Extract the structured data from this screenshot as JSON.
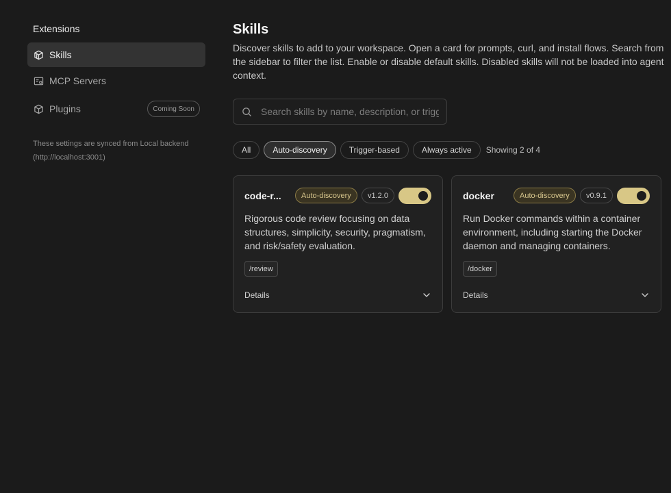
{
  "sidebar": {
    "heading": "Extensions",
    "items": [
      {
        "label": "Skills",
        "icon": "skills-cube-icon"
      },
      {
        "label": "MCP Servers",
        "icon": "server-icon"
      },
      {
        "label": "Plugins",
        "icon": "plugin-cube-icon",
        "badge": "Coming Soon"
      }
    ],
    "sync_note": "These settings are synced from Local backend (http://localhost:3001)"
  },
  "main": {
    "title": "Skills",
    "description": "Discover skills to add to your workspace. Open a card for prompts, curl, and install flows. Search from the sidebar to filter the list. Enable or disable default skills. Disabled skills will not be loaded into agent context.",
    "search": {
      "placeholder": "Search skills by name, description, or trigger",
      "value": ""
    },
    "filters": [
      {
        "label": "All",
        "active": false
      },
      {
        "label": "Auto-discovery",
        "active": true
      },
      {
        "label": "Trigger-based",
        "active": false
      },
      {
        "label": "Always active",
        "active": false
      }
    ],
    "showing": "Showing 2 of 4",
    "cards": [
      {
        "name": "code-r...",
        "mode": "Auto-discovery",
        "version": "v1.2.0",
        "enabled": true,
        "description": "Rigorous code review focusing on data structures, simplicity, security, pragmatism, and risk/safety evaluation.",
        "trigger": "/review",
        "details_label": "Details"
      },
      {
        "name": "docker",
        "mode": "Auto-discovery",
        "version": "v0.9.1",
        "enabled": true,
        "description": "Run Docker commands within a container environment, including starting the Docker daemon and managing containers.",
        "trigger": "/docker",
        "details_label": "Details"
      }
    ]
  },
  "colors": {
    "background": "#1b1b1b",
    "accent": "#d8c786",
    "active_nav": "#333333"
  }
}
